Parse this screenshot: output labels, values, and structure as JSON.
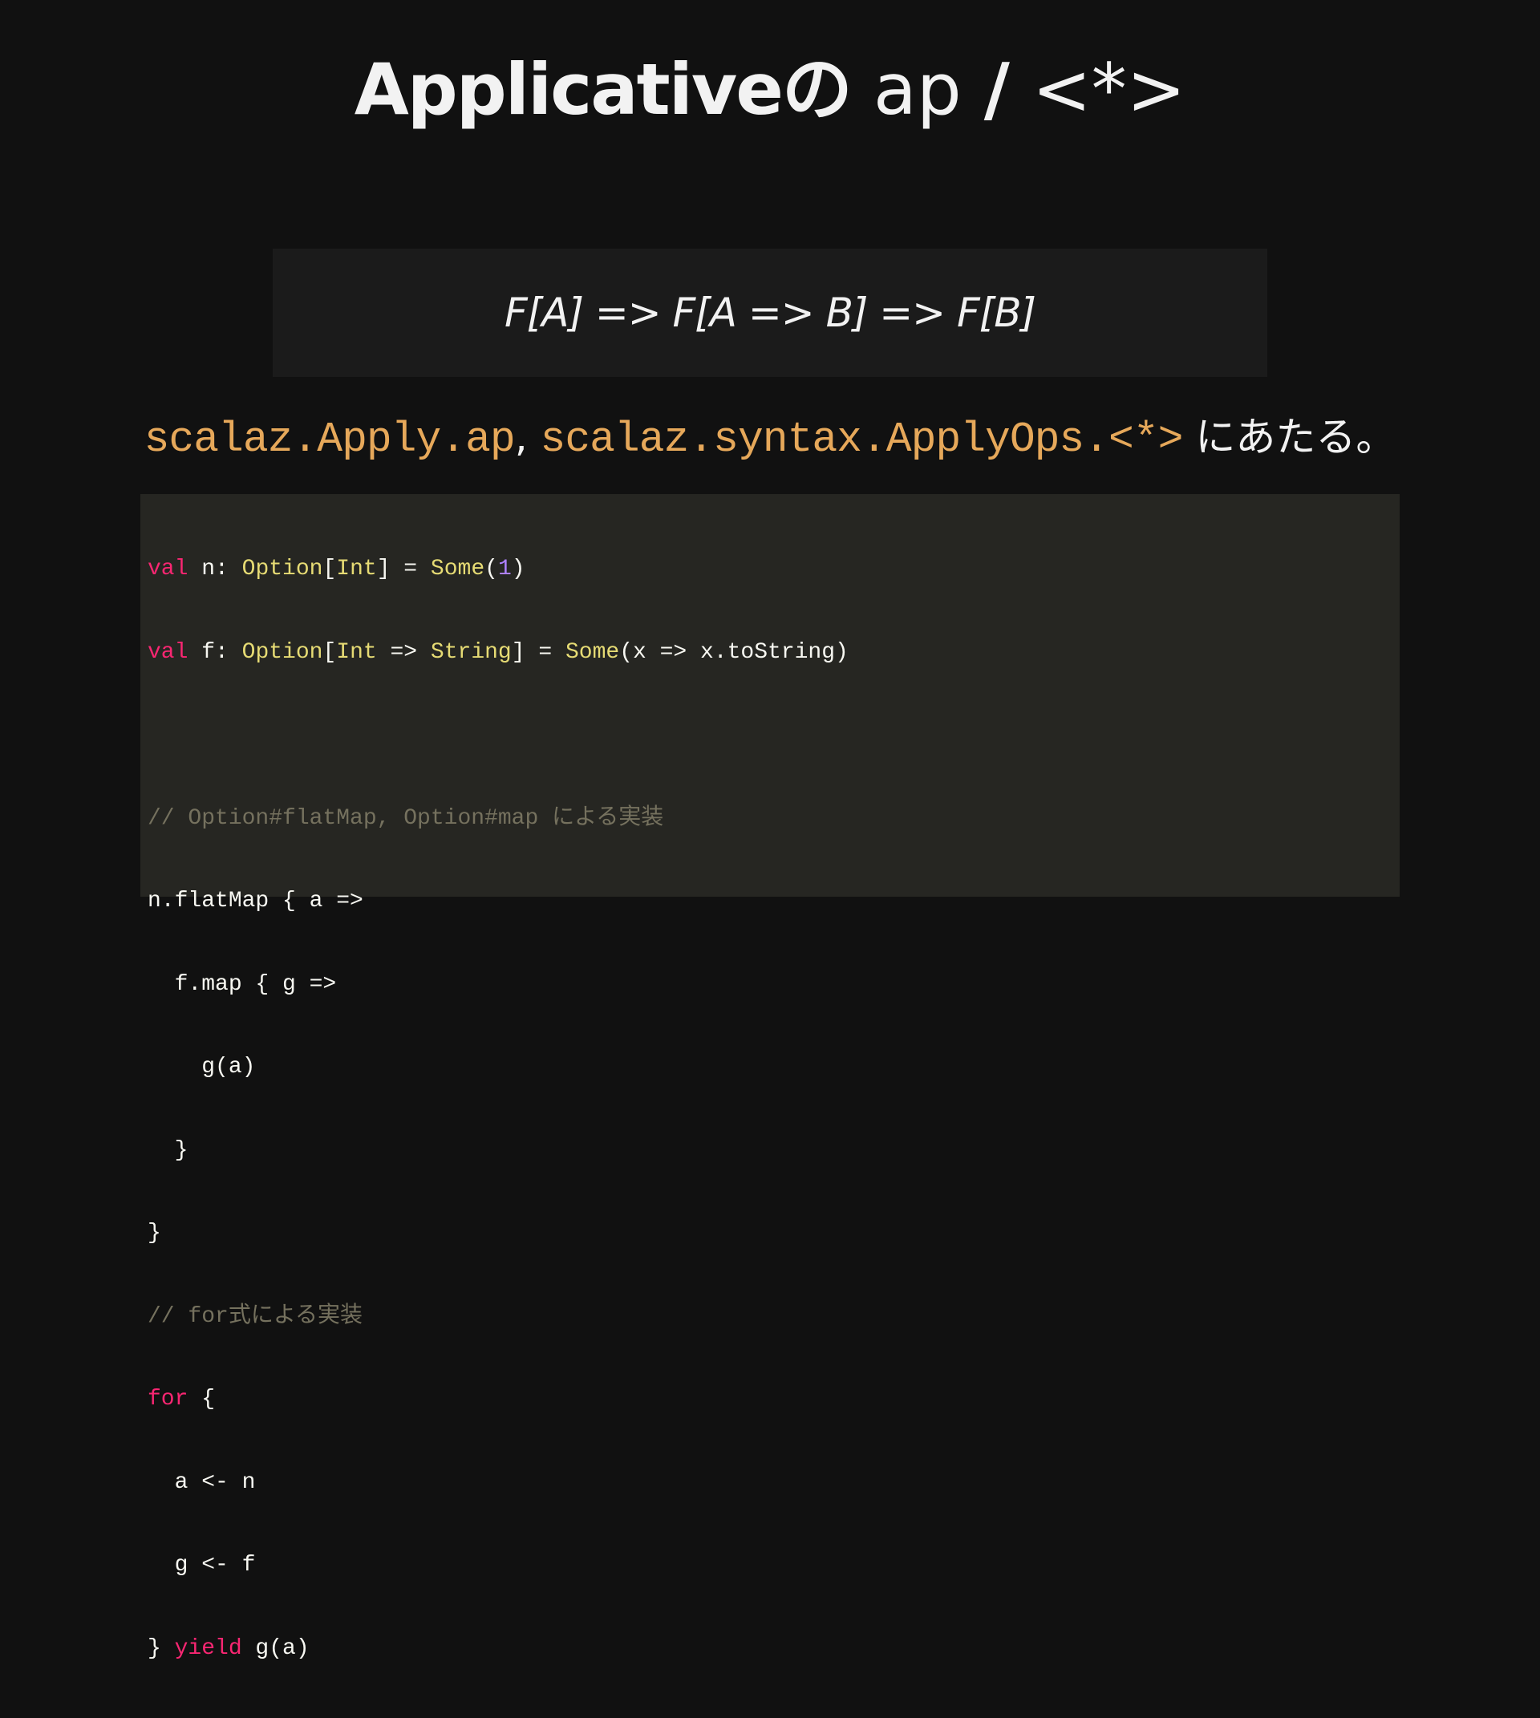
{
  "title": {
    "bold": "Applicativeの",
    "light": "ap",
    "slash": "/",
    "op": "<*>"
  },
  "signature": "F[A] => F[A => B] => F[B]",
  "description": {
    "ref1": "scalaz.Apply.ap",
    "sep": ",",
    "ref2": "scalaz.syntax.ApplyOps.<*>",
    "tail": "にあたる。"
  },
  "code": {
    "line1": [
      {
        "t": "val",
        "c": "kw"
      },
      {
        "t": " n: ",
        "c": ""
      },
      {
        "t": "Option",
        "c": "ty"
      },
      {
        "t": "[",
        "c": ""
      },
      {
        "t": "Int",
        "c": "ty"
      },
      {
        "t": "] = ",
        "c": ""
      },
      {
        "t": "Some",
        "c": "ty"
      },
      {
        "t": "(",
        "c": ""
      },
      {
        "t": "1",
        "c": "num"
      },
      {
        "t": ")",
        "c": ""
      }
    ],
    "line2": [
      {
        "t": "val",
        "c": "kw"
      },
      {
        "t": " f: ",
        "c": ""
      },
      {
        "t": "Option",
        "c": "ty"
      },
      {
        "t": "[",
        "c": ""
      },
      {
        "t": "Int",
        "c": "ty"
      },
      {
        "t": " => ",
        "c": ""
      },
      {
        "t": "String",
        "c": "ty"
      },
      {
        "t": "] = ",
        "c": ""
      },
      {
        "t": "Some",
        "c": "ty"
      },
      {
        "t": "(x => x.toString)",
        "c": ""
      }
    ],
    "line3": [],
    "line4": [
      {
        "t": "// Option#flatMap, Option#map による実装",
        "c": "cm"
      }
    ],
    "line5": [
      {
        "t": "n.flatMap { a =>",
        "c": ""
      }
    ],
    "line6": [
      {
        "t": "  f.map { g =>",
        "c": ""
      }
    ],
    "line7": [
      {
        "t": "    g(a)",
        "c": ""
      }
    ],
    "line8": [
      {
        "t": "  }",
        "c": ""
      }
    ],
    "line9": [
      {
        "t": "}",
        "c": ""
      }
    ],
    "line10": [
      {
        "t": "// for式による実装",
        "c": "cm"
      }
    ],
    "line11": [
      {
        "t": "for",
        "c": "kw"
      },
      {
        "t": " {",
        "c": ""
      }
    ],
    "line12": [
      {
        "t": "  a <- n",
        "c": ""
      }
    ],
    "line13": [
      {
        "t": "  g <- f",
        "c": ""
      }
    ],
    "line14": [
      {
        "t": "} ",
        "c": ""
      },
      {
        "t": "yield",
        "c": "kw"
      },
      {
        "t": " g(a)",
        "c": ""
      }
    ]
  },
  "colors": {
    "background": "#111111",
    "signature_box": "#1b1b1b",
    "code_box": "#262622",
    "reference": "#e6a85a",
    "keyword": "#f92672",
    "type": "#e6db74",
    "number": "#ae81ff",
    "comment": "#75715e"
  }
}
